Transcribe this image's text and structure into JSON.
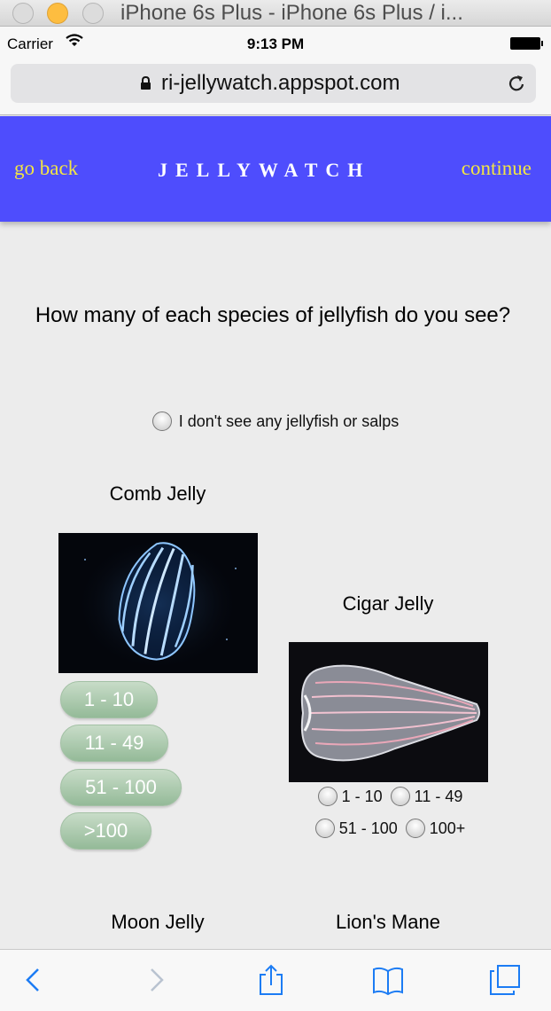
{
  "window": {
    "title": "iPhone 6s Plus - iPhone 6s Plus / i..."
  },
  "status_bar": {
    "carrier": "Carrier",
    "time": "9:13 PM"
  },
  "browser": {
    "url": "ri-jellywatch.appspot.com"
  },
  "header": {
    "back_label": "go back",
    "brand": "JELLYWATCH",
    "continue_label": "continue",
    "bg_color": "#4e4dfd",
    "link_color": "#f2e544"
  },
  "question": "How many of each species of jellyfish do you see?",
  "none_option": "I don't see any jellyfish or salps",
  "species": {
    "comb": {
      "name": "Comb Jelly",
      "options": [
        "1 - 10",
        "11 - 49",
        "51 - 100",
        ">100"
      ]
    },
    "cigar": {
      "name": "Cigar Jelly",
      "options": [
        "1 - 10",
        "11 - 49",
        "51 - 100",
        "100+"
      ]
    },
    "moon": {
      "name": "Moon Jelly"
    },
    "lions_mane": {
      "name": "Lion's Mane"
    }
  },
  "toolbar": {
    "icons": [
      "back-icon",
      "forward-icon",
      "share-icon",
      "bookmarks-icon",
      "tabs-icon"
    ]
  }
}
